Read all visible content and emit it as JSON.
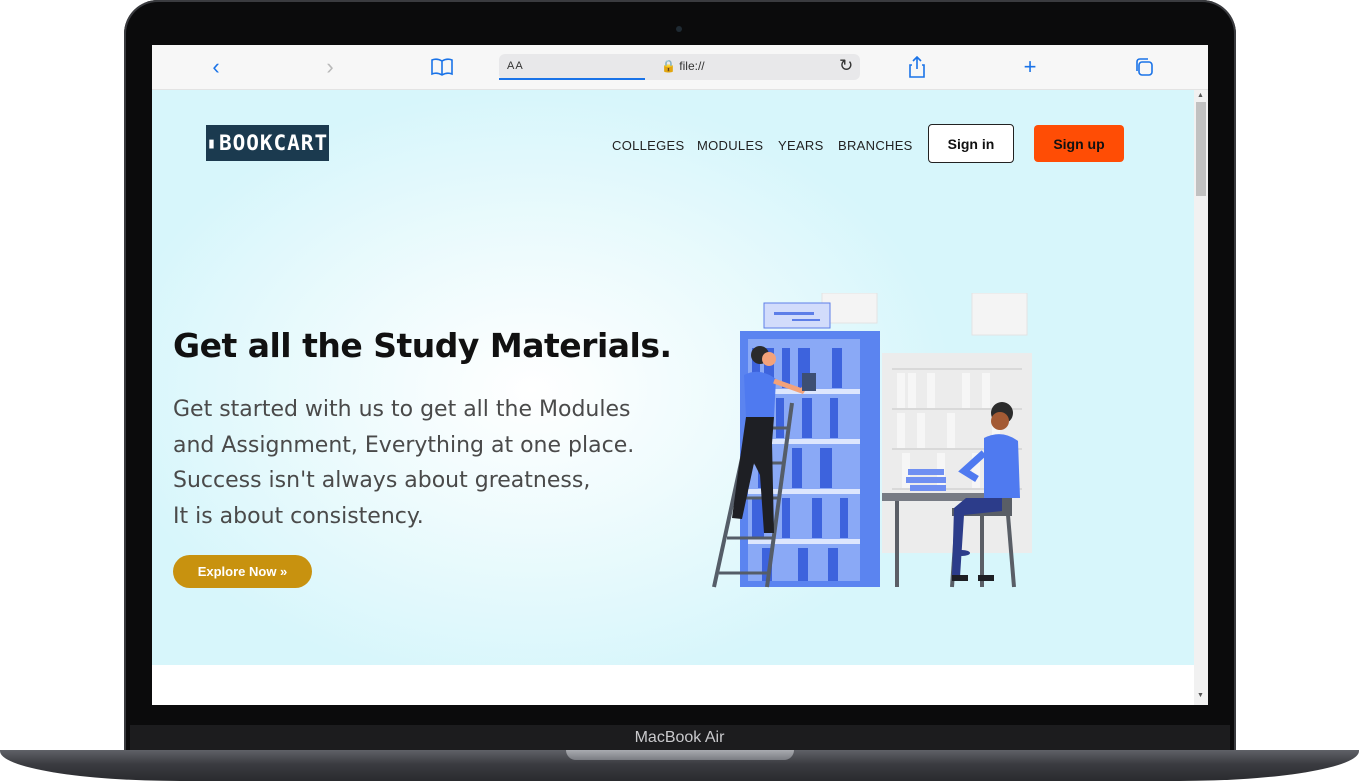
{
  "device": {
    "label": "MacBook Air"
  },
  "browser": {
    "url_display": "file://",
    "text_size_label": "AA",
    "icons": [
      "chevron-left-icon",
      "chevron-right-icon",
      "book-icon",
      "lock-icon",
      "reload-icon",
      "share-icon",
      "plus-icon",
      "tabs-icon"
    ]
  },
  "site": {
    "logo_text": "BOOKCART",
    "nav": [
      "COLLEGES",
      "MODULES",
      "YEARS",
      "BRANCHES"
    ],
    "sign_in": "Sign in",
    "sign_up": "Sign up"
  },
  "hero": {
    "headline": "Get all the Study Materials.",
    "lines": [
      "Get started with us to get all the Modules",
      "and Assignment, Everything at one place.",
      "Success isn't always about greatness,",
      "It is about consistency."
    ],
    "cta": "Explore Now »"
  },
  "colors": {
    "logo_bg": "#1b3a4f",
    "signup_bg": "#ff4d05",
    "cta_bg": "#c8920f",
    "hero_bg": "#d7f6fb",
    "browser_accent": "#1a73e8"
  }
}
